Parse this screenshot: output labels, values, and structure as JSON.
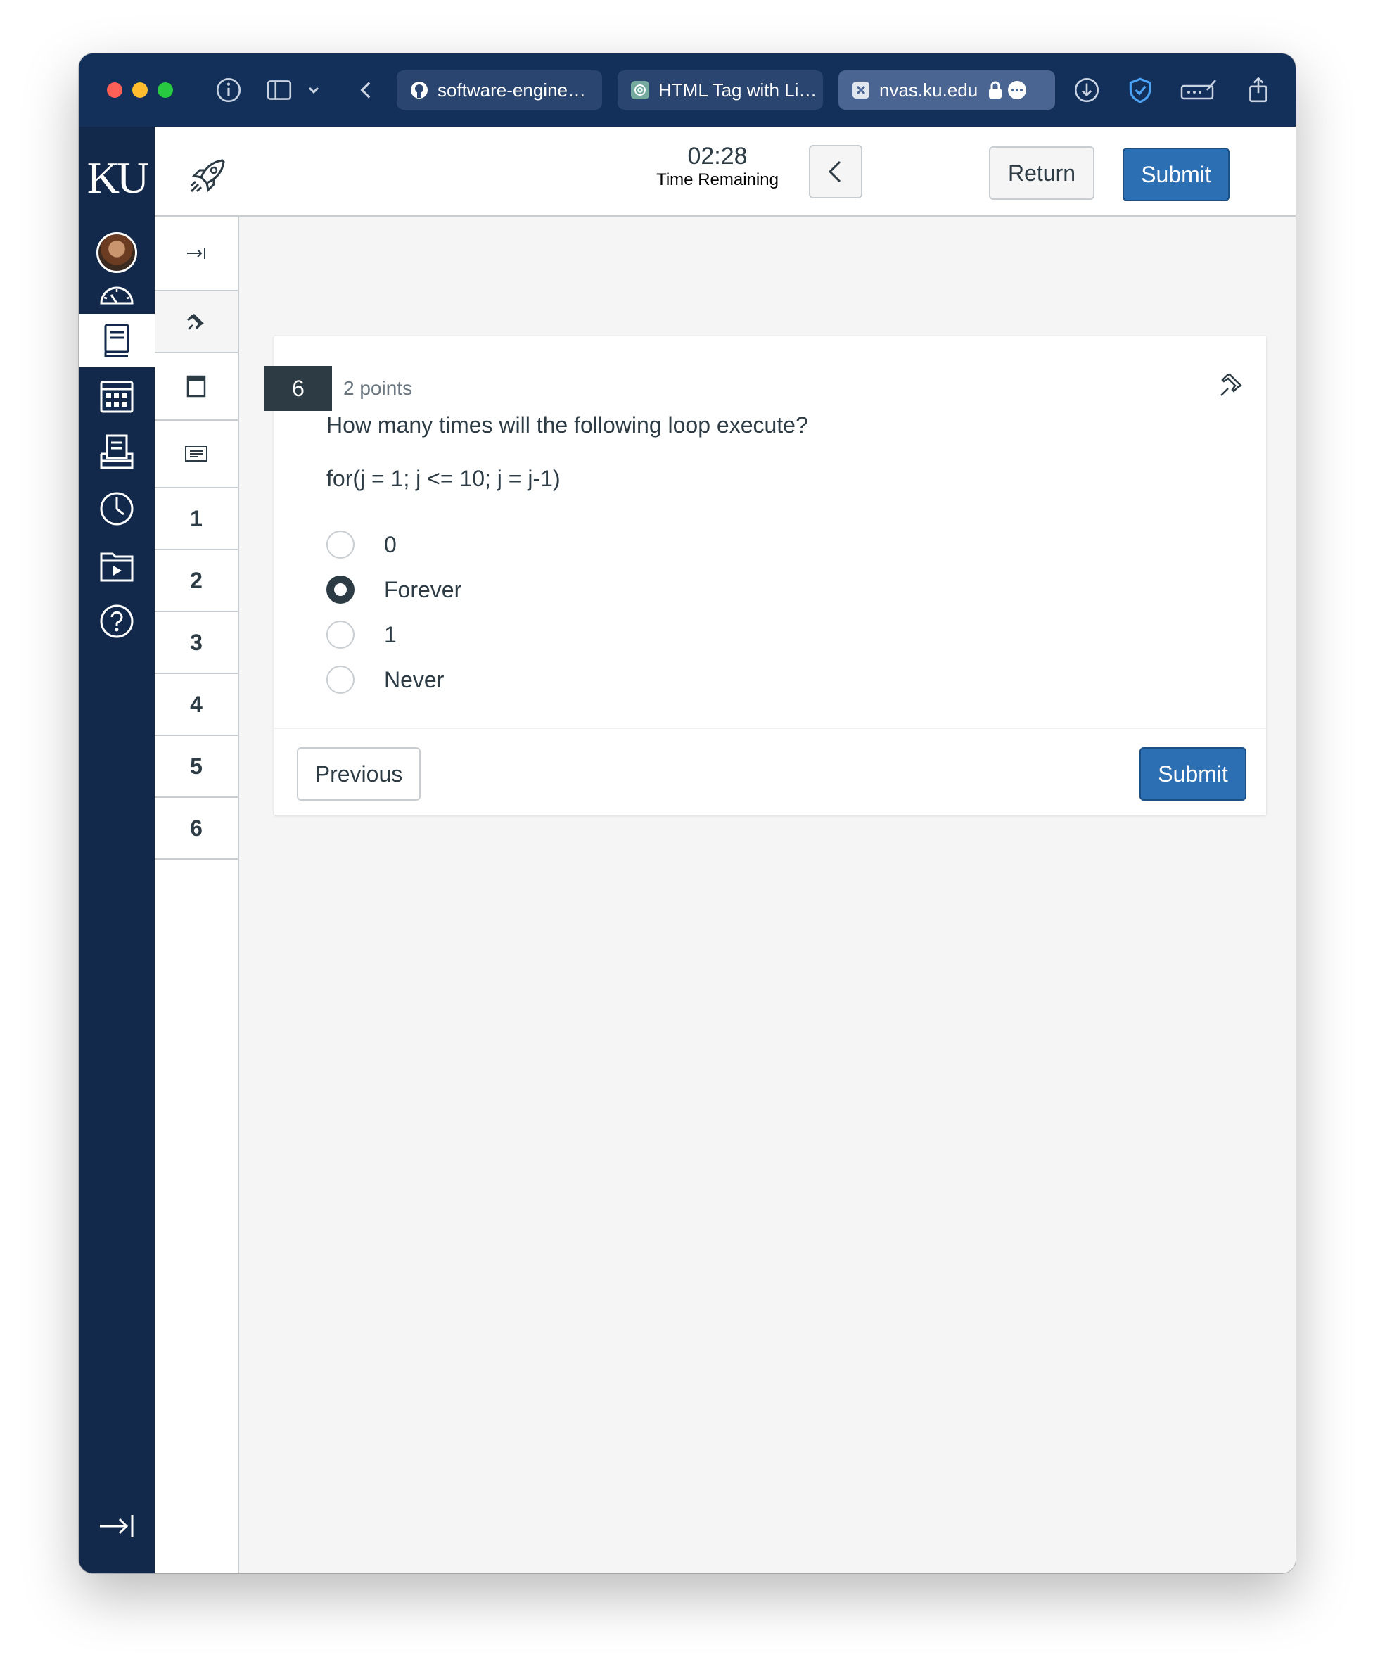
{
  "browser": {
    "tabs": [
      {
        "label": "software-engine…",
        "icon": "github-icon"
      },
      {
        "label": "HTML Tag with Li…",
        "icon": "chatgpt-icon"
      },
      {
        "label": "nvas.ku.edu",
        "icon": "close-tab-icon"
      }
    ]
  },
  "nav": {
    "logo": "KU",
    "items": [
      "account",
      "dashboard",
      "courses",
      "calendar",
      "inbox",
      "history",
      "studio",
      "help"
    ]
  },
  "header": {
    "timer_value": "02:28",
    "timer_label": "Time Remaining",
    "return_label": "Return",
    "submit_label": "Submit"
  },
  "question_nav": {
    "numbers": [
      "1",
      "2",
      "3",
      "4",
      "5",
      "6"
    ]
  },
  "question": {
    "number": "6",
    "points": "2 points",
    "text": "How many times will the following loop execute?",
    "code": "for(j = 1; j <= 10; j = j-1)",
    "options": [
      {
        "label": "0",
        "selected": false
      },
      {
        "label": "Forever",
        "selected": true
      },
      {
        "label": "1",
        "selected": false
      },
      {
        "label": "Never",
        "selected": false
      }
    ]
  },
  "footer": {
    "previous_label": "Previous",
    "submit_label": "Submit"
  },
  "colors": {
    "nav_bg": "#13294b",
    "primary_button": "#2d6fb3",
    "text": "#2d3b45"
  }
}
